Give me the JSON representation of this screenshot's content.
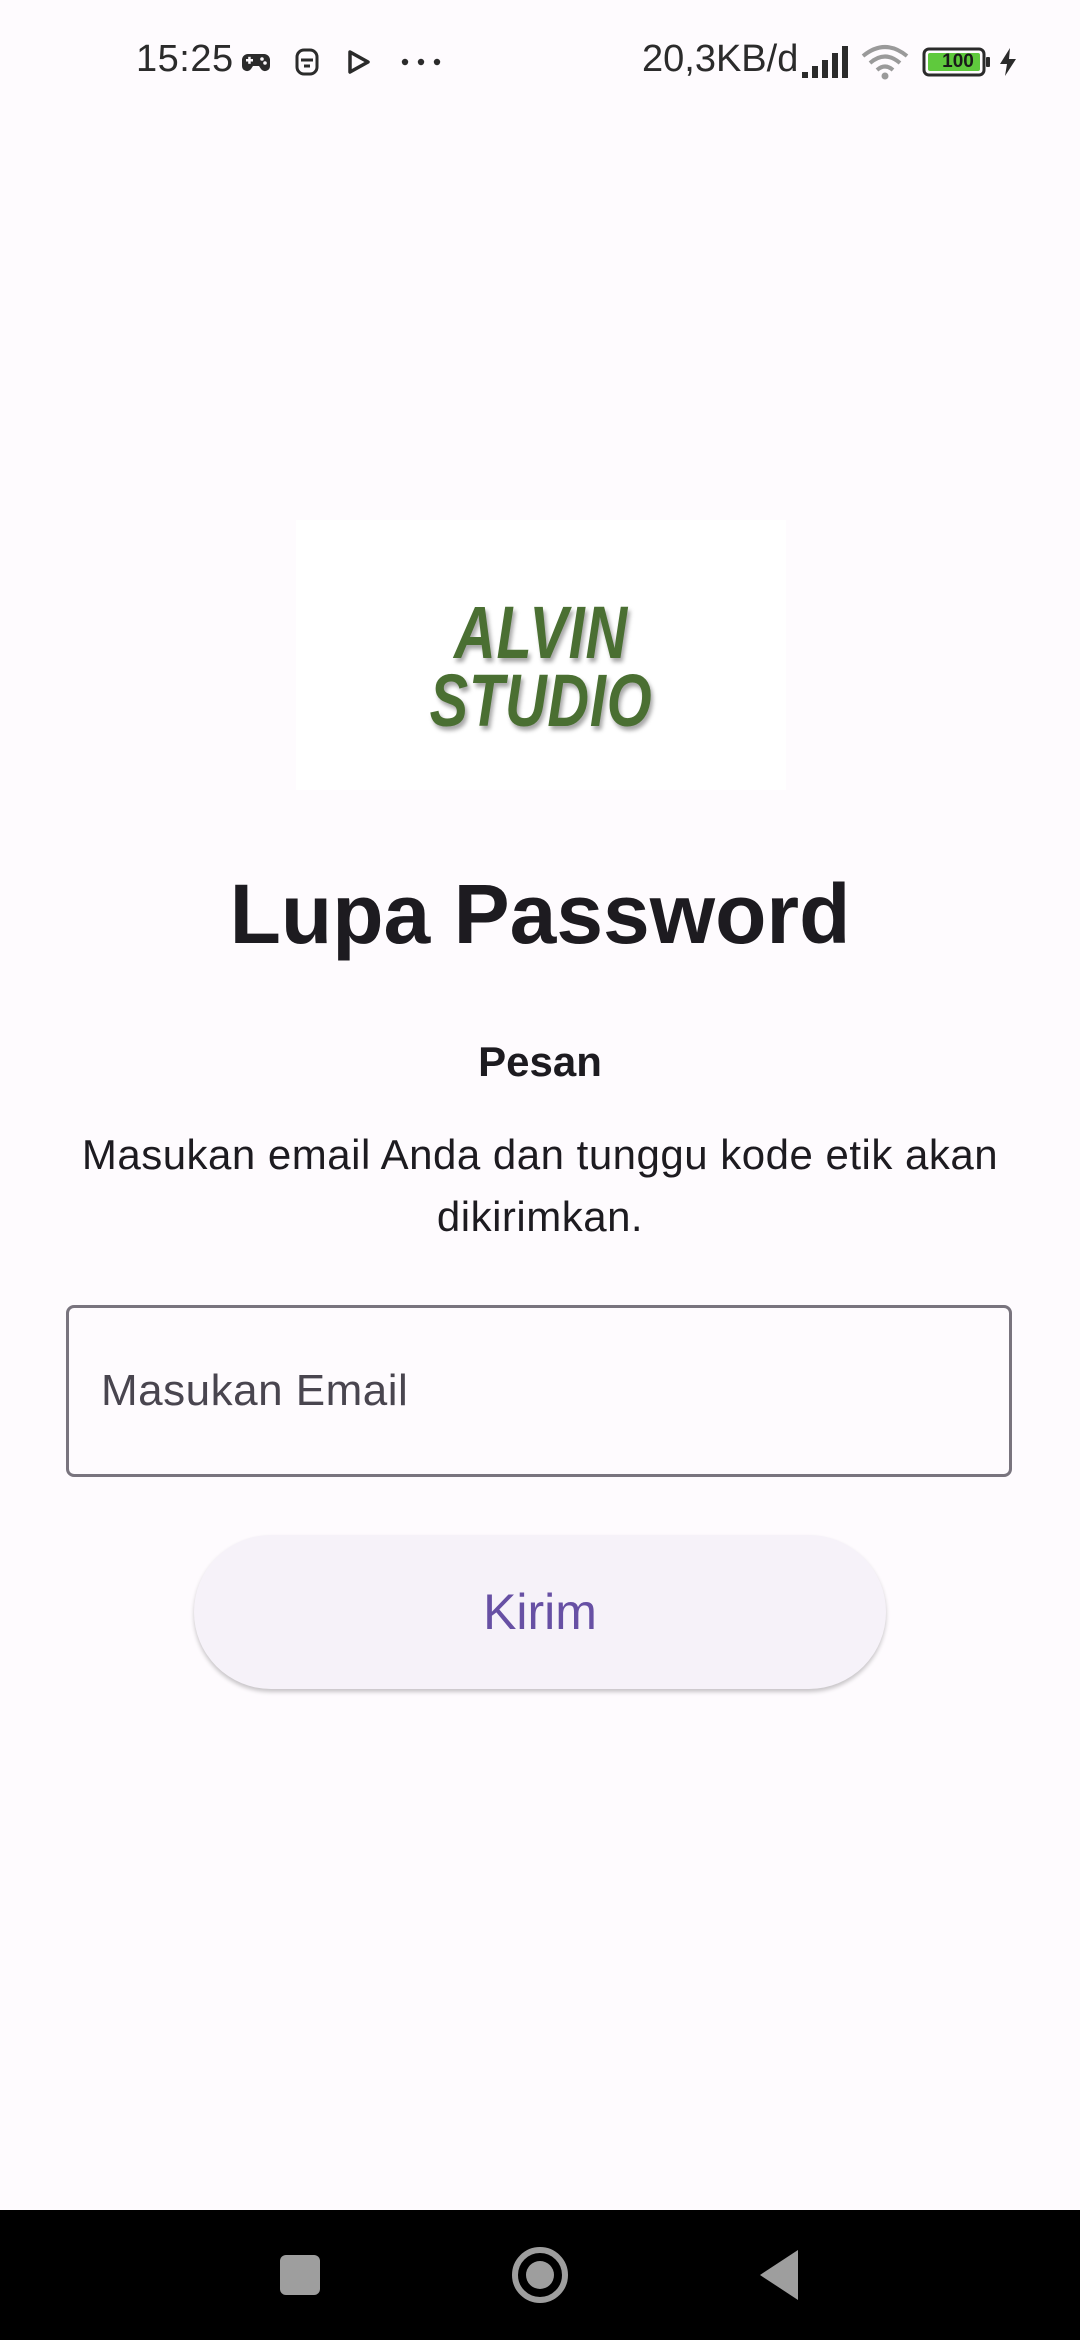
{
  "status_bar": {
    "time": "15:25",
    "network_speed": "20,3KB/d",
    "battery_level": "100",
    "left_icons": [
      "game-controller-icon",
      "app-notification-icon",
      "play-store-icon",
      "more-dots-icon"
    ],
    "right_icons": [
      "signal-icon",
      "wifi-icon",
      "battery-icon",
      "charging-icon"
    ]
  },
  "logo": {
    "line1": "ALVIN",
    "line2": "STUDIO",
    "color": "#4a6f32"
  },
  "page": {
    "title": "Lupa Password",
    "message_heading": "Pesan",
    "message_body": "Masukan email Anda dan tunggu kode etik akan dikirimkan."
  },
  "email_input": {
    "placeholder": "Masukan Email",
    "value": ""
  },
  "submit_button": {
    "label": "Kirim",
    "text_color": "#6750a4"
  },
  "nav_bar": {
    "buttons": [
      "recents-button",
      "home-button",
      "back-button"
    ]
  }
}
